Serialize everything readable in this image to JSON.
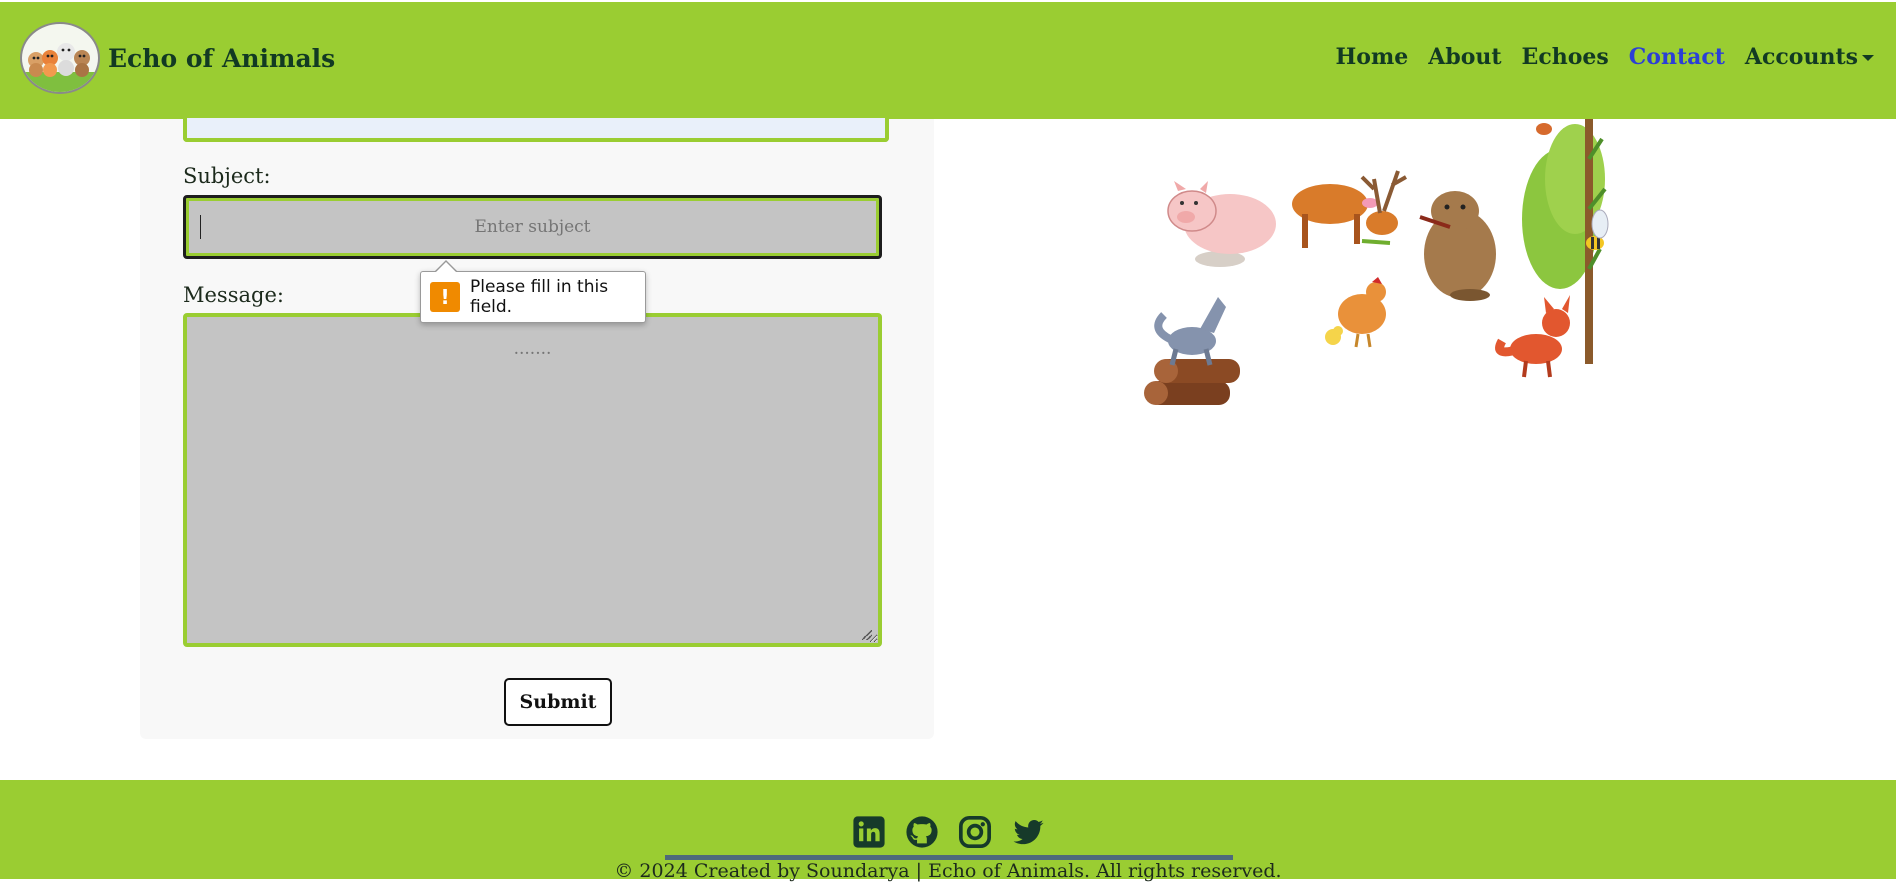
{
  "header": {
    "brand_name": "Echo of Animals",
    "nav": [
      {
        "label": "Home",
        "active": false
      },
      {
        "label": "About",
        "active": false
      },
      {
        "label": "Echoes",
        "active": false
      },
      {
        "label": "Contact",
        "active": true
      },
      {
        "label": "Accounts",
        "active": false,
        "dropdown": true
      }
    ]
  },
  "form": {
    "subject_label": "Subject:",
    "subject_placeholder": "Enter subject",
    "subject_value": "",
    "message_label": "Message:",
    "message_placeholder": ".......",
    "message_value": "",
    "submit_label": "Submit",
    "validation_message": "Please fill in this field."
  },
  "footer": {
    "socials": [
      "linkedin-icon",
      "github-icon",
      "instagram-icon",
      "twitter-icon"
    ],
    "copyright": "© 2024 Created by Soundarya | Echo of Animals. All rights reserved."
  },
  "colors": {
    "accent": "#9acd32",
    "nav_text": "#123a23",
    "nav_active": "#2b3fd6",
    "warning": "#f08a00"
  }
}
